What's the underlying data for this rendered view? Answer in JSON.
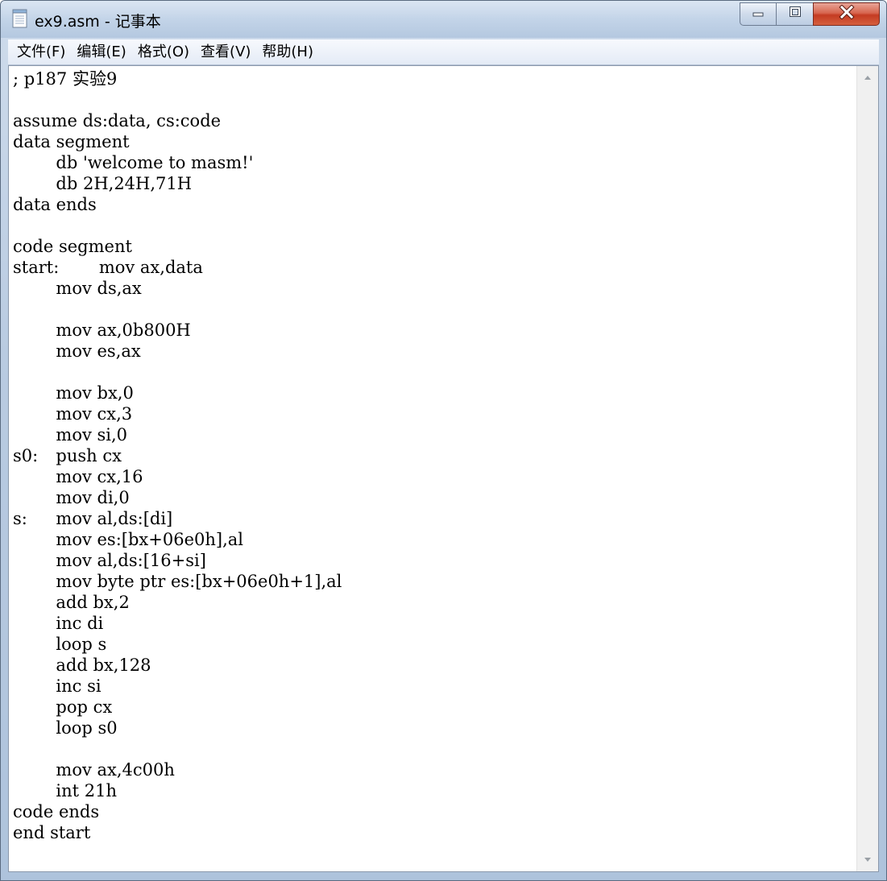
{
  "window": {
    "title": "ex9.asm - 记事本",
    "icon": "notepad-icon"
  },
  "titlebar_buttons": {
    "minimize_icon": "minimize-icon",
    "maximize_icon": "maximize-icon",
    "close_icon": "close-icon"
  },
  "menu": {
    "items": [
      {
        "label": "文件(F)"
      },
      {
        "label": "编辑(E)"
      },
      {
        "label": "格式(O)"
      },
      {
        "label": "查看(V)"
      },
      {
        "label": "帮助(H)"
      }
    ]
  },
  "editor": {
    "content": "; p187 实验9\n\nassume ds:data, cs:code\ndata segment\n\tdb 'welcome to masm!'\n\tdb 2H,24H,71H\ndata ends\n\ncode segment\nstart:\tmov ax,data\n\tmov ds,ax\n\n\tmov ax,0b800H\n\tmov es,ax\n\n\tmov bx,0\n\tmov cx,3\n\tmov si,0\ns0:\tpush cx\n\tmov cx,16\n\tmov di,0\ns:\tmov al,ds:[di]\n\tmov es:[bx+06e0h],al\n\tmov al,ds:[16+si]\n\tmov byte ptr es:[bx+06e0h+1],al\n\tadd bx,2\n\tinc di\n\tloop s\n\tadd bx,128\n\tinc si\n\tpop cx\n\tloop s0\n\n\tmov ax,4c00h\n\tint 21h\ncode ends\nend start"
  },
  "colors": {
    "titlebar": "#c3d4e8",
    "close_button": "#c43b22",
    "text": "#000000",
    "background": "#ffffff"
  }
}
